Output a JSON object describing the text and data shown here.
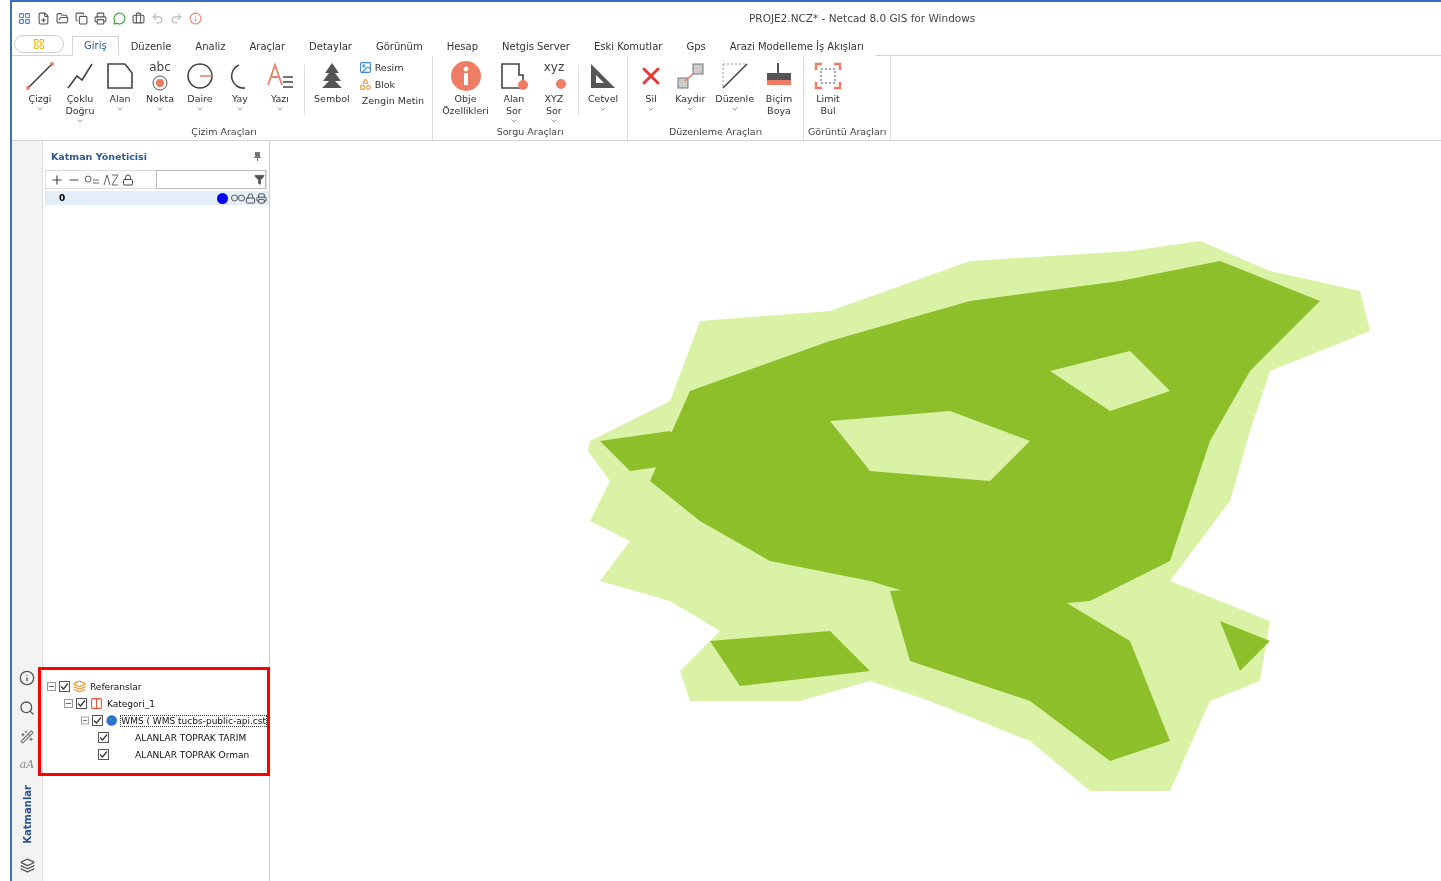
{
  "window": {
    "title": "PROJE2.NCZ* - Netcad 8.0 GIS for Windows"
  },
  "tabs": [
    {
      "label": "Giriş",
      "selected": true
    },
    {
      "label": "Düzenle",
      "selected": false
    },
    {
      "label": "Analiz",
      "selected": false
    },
    {
      "label": "Araçlar",
      "selected": false
    },
    {
      "label": "Detaylar",
      "selected": false
    },
    {
      "label": "Görünüm",
      "selected": false
    },
    {
      "label": "Hesap",
      "selected": false
    },
    {
      "label": "Netgis Server",
      "selected": false
    },
    {
      "label": "Eski Komutlar",
      "selected": false
    },
    {
      "label": "Gps",
      "selected": false
    },
    {
      "label": "Arazi Modelleme İş Akışları",
      "selected": false
    }
  ],
  "ribbon_groups": [
    {
      "label": "Çizim Araçları",
      "items": [
        {
          "kind": "large",
          "lines": [
            "Çizgi"
          ],
          "dropdown": true
        },
        {
          "kind": "large",
          "lines": [
            "Çoklu",
            "Doğru"
          ],
          "dropdown": true
        },
        {
          "kind": "large",
          "lines": [
            "Alan"
          ],
          "dropdown": true
        },
        {
          "kind": "large",
          "lines": [
            "Nokta"
          ],
          "dropdown": true,
          "icon_text": "abc"
        },
        {
          "kind": "large",
          "lines": [
            "Daire"
          ],
          "dropdown": true
        },
        {
          "kind": "large",
          "lines": [
            "Yay"
          ],
          "dropdown": true
        },
        {
          "kind": "large",
          "lines": [
            "Yazı"
          ],
          "dropdown": true
        },
        {
          "kind": "separator"
        },
        {
          "kind": "large",
          "lines": [
            "Sembol"
          ],
          "dropdown": false
        },
        {
          "kind": "small_stack",
          "entries": [
            "Resim",
            "Blok",
            "Zengin Metin"
          ]
        }
      ]
    },
    {
      "label": "Sorgu Araçları",
      "items": [
        {
          "kind": "large",
          "lines": [
            "Obje",
            "Özellikleri"
          ],
          "dropdown": false
        },
        {
          "kind": "large",
          "lines": [
            "Alan",
            "Sor"
          ],
          "dropdown": true
        },
        {
          "kind": "large",
          "lines": [
            "XYZ",
            "Sor"
          ],
          "dropdown": true,
          "icon_text": "xyz"
        },
        {
          "kind": "separator"
        },
        {
          "kind": "large",
          "lines": [
            "Cetvel"
          ],
          "dropdown": true
        }
      ]
    },
    {
      "label": "Düzenleme Araçları",
      "items": [
        {
          "kind": "large",
          "lines": [
            "Sil"
          ],
          "dropdown": true
        },
        {
          "kind": "large",
          "lines": [
            "Kaydır"
          ],
          "dropdown": true
        },
        {
          "kind": "large",
          "lines": [
            "Düzenle"
          ],
          "dropdown": true
        },
        {
          "kind": "large",
          "lines": [
            "Biçim",
            "Boya"
          ],
          "dropdown": false
        }
      ]
    },
    {
      "label": "Görüntü Araçları",
      "items": [
        {
          "kind": "large",
          "lines": [
            "Limit",
            "Bul"
          ],
          "dropdown": false
        }
      ]
    }
  ],
  "side_strip": {
    "font_glyph": "aA",
    "tab_label": "Katmanlar"
  },
  "layer_manager": {
    "title": "Katman Yöneticisi",
    "layers": [
      {
        "name": "0",
        "color": "#0000ff",
        "selected": true
      }
    ],
    "tree": [
      {
        "label": "Referanslar",
        "checked": true,
        "expanded": true,
        "selected": false,
        "kind": "group",
        "children": [
          {
            "label": "Kategori_1",
            "checked": true,
            "expanded": true,
            "selected": false,
            "kind": "category",
            "children": [
              {
                "label": "WMS ( WMS tucbs-public-api.cst",
                "checked": true,
                "expanded": true,
                "selected": true,
                "kind": "service",
                "children": [
                  {
                    "label": "ALANLAR TOPRAK TARIM",
                    "checked": true,
                    "selected": false,
                    "kind": "layer"
                  },
                  {
                    "label": "ALANLAR TOPRAK Orman",
                    "checked": true,
                    "selected": false,
                    "kind": "layer"
                  }
                ]
              }
            ]
          }
        ]
      }
    ]
  }
}
